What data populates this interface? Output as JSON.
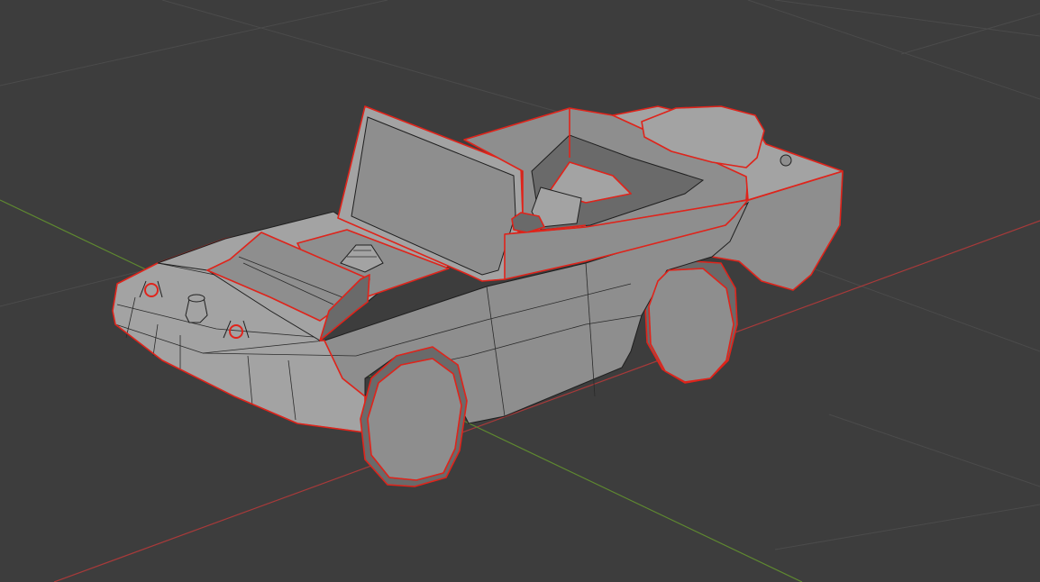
{
  "viewport": {
    "background": "#3d3d3d",
    "grid_color": "#4a4a4a",
    "x_axis_color": "#b03a3a",
    "y_axis_color": "#6e9a3a"
  },
  "selection": {
    "outline_color": "#e0241b"
  },
  "object": {
    "shading": "solid",
    "face_color": "#8e8e8e"
  }
}
